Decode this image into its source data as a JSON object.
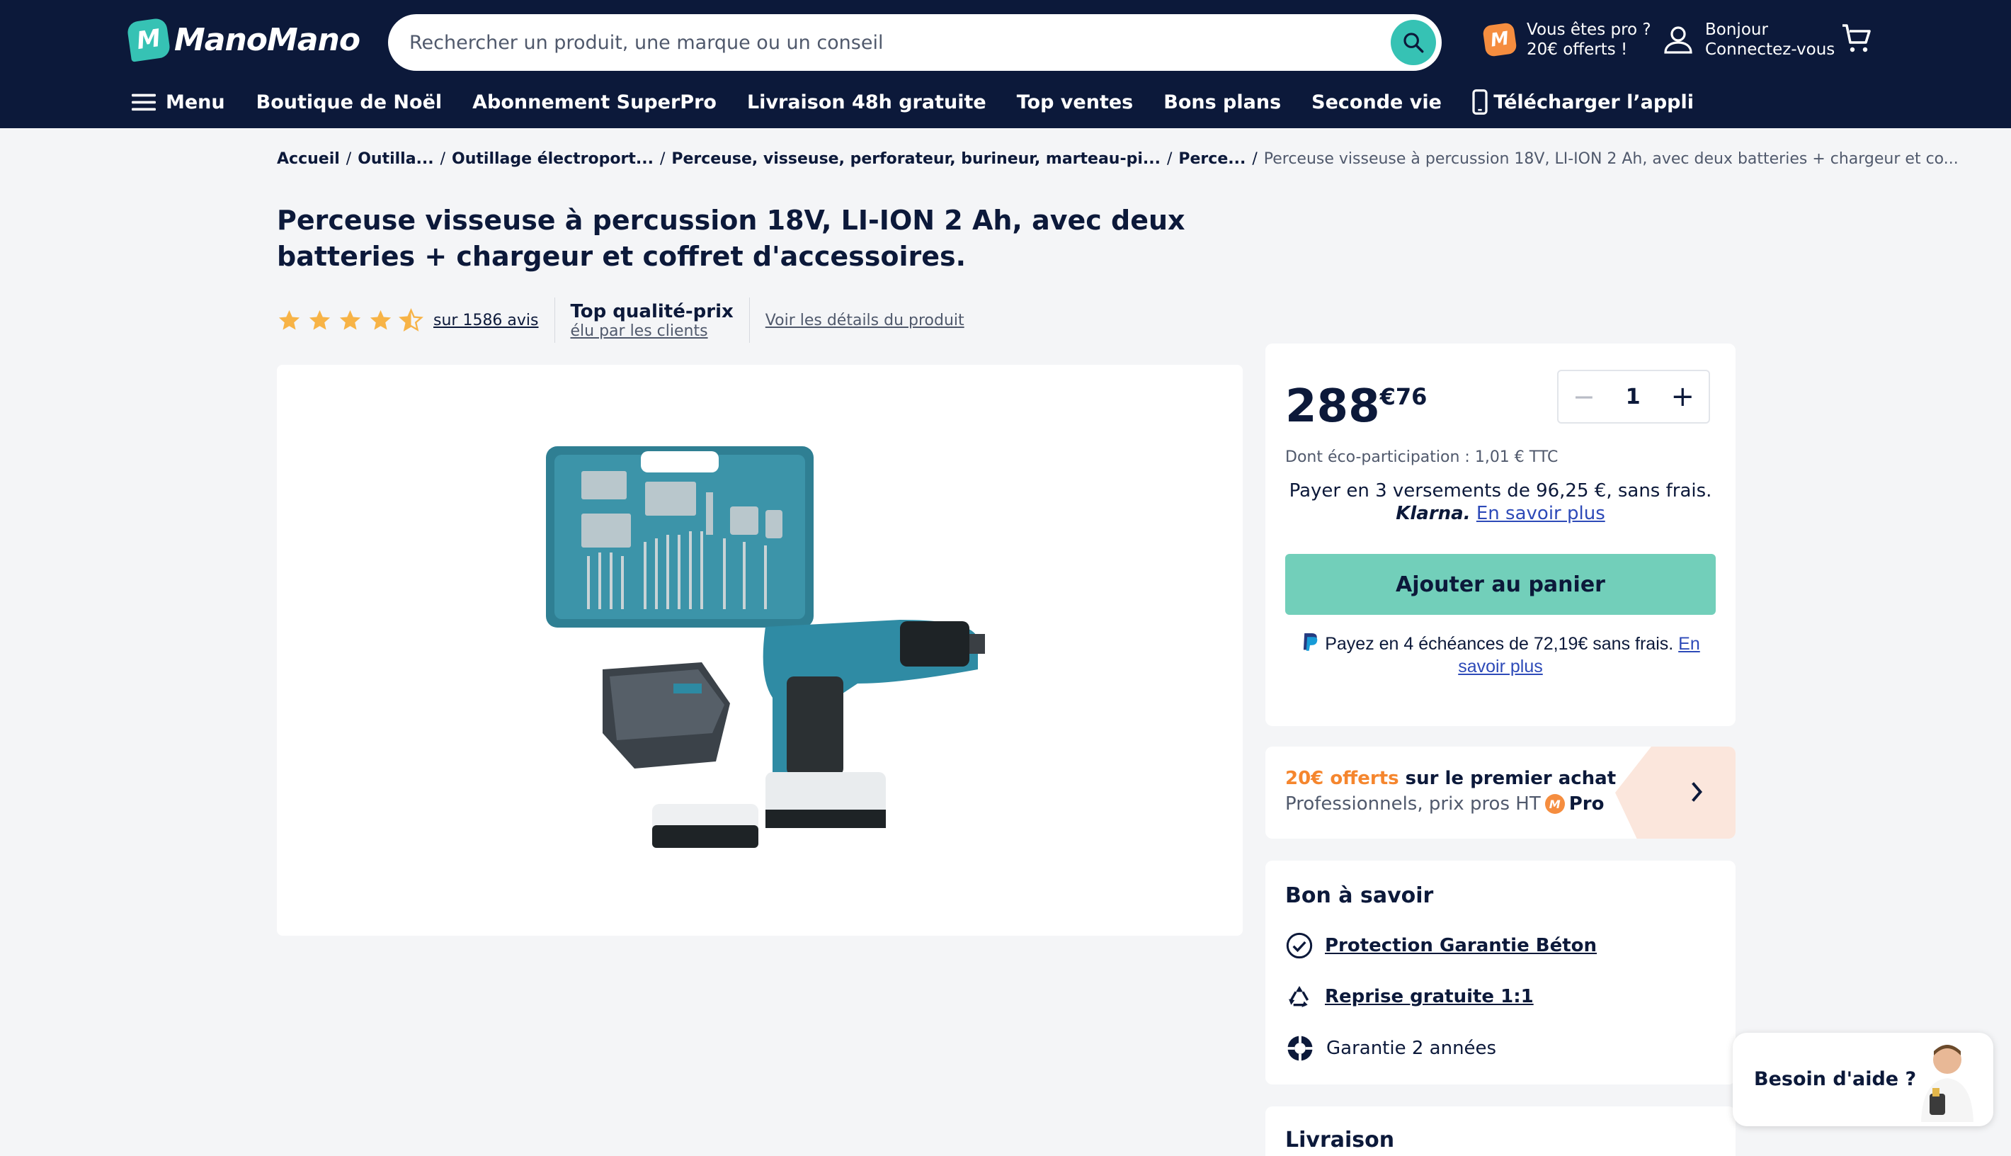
{
  "header": {
    "logo_text": "ManoMano",
    "search_placeholder": "Rechercher un produit, une marque ou un conseil",
    "pro_line1": "Vous êtes pro ?",
    "pro_line2": "20€ offerts !",
    "account_line1": "Bonjour",
    "account_line2": "Connectez-vous",
    "menu_label": "Menu",
    "nav_items": [
      "Boutique de Noël",
      "Abonnement SuperPro",
      "Livraison 48h gratuite",
      "Top ventes",
      "Bons plans",
      "Seconde vie"
    ],
    "app_download": "Télécharger l’appli"
  },
  "breadcrumb": {
    "items": [
      "Accueil",
      "Outilla...",
      "Outillage électroport...",
      "Perceuse, visseuse, perforateur, burineur, marteau-pi...",
      "Perce..."
    ],
    "current": "Perceuse visseuse à percussion 18V, LI-ION 2 Ah, avec deux batteries + chargeur et co..."
  },
  "product": {
    "title": "Perceuse visseuse à percussion 18V, LI-ION 2 Ah, avec deux batteries + chargeur et coffret d'accessoires.",
    "rating": 4.5,
    "reviews": "sur 1586 avis",
    "quality_title": "Top qualité-prix",
    "quality_sub": "élu par les clients",
    "details_link": "Voir les détails du produit"
  },
  "buybox": {
    "price_int": "288",
    "price_dec": "€76",
    "quantity": "1",
    "eco": "Dont éco-participation : 1,01 € TTC",
    "klarna_text": "Payer en 3 versements de 96,25 €, sans frais.",
    "klarna_logo": "Klarna.",
    "klarna_link": "En savoir plus",
    "add_to_cart": "Ajouter au panier",
    "paypal_text": "Payez en 4 échéances de 72,19€ sans frais.",
    "paypal_link": "En savoir plus"
  },
  "promo": {
    "orange": "20€ offerts",
    "rest": " sur le premier achat",
    "line2": "Professionnels, prix pros HT",
    "pro_word": "Pro"
  },
  "good_to_know": {
    "title": "Bon à savoir",
    "items": [
      "Protection Garantie Béton",
      "Reprise gratuite 1:1",
      "Garantie 2 années"
    ]
  },
  "delivery": {
    "title": "Livraison"
  },
  "help": {
    "label": "Besoin d'aide ?"
  },
  "colors": {
    "navy": "#0c193a",
    "teal": "#36c2b4",
    "cart_button": "#72cfba",
    "orange": "#f5862e",
    "star": "#f7b346"
  }
}
